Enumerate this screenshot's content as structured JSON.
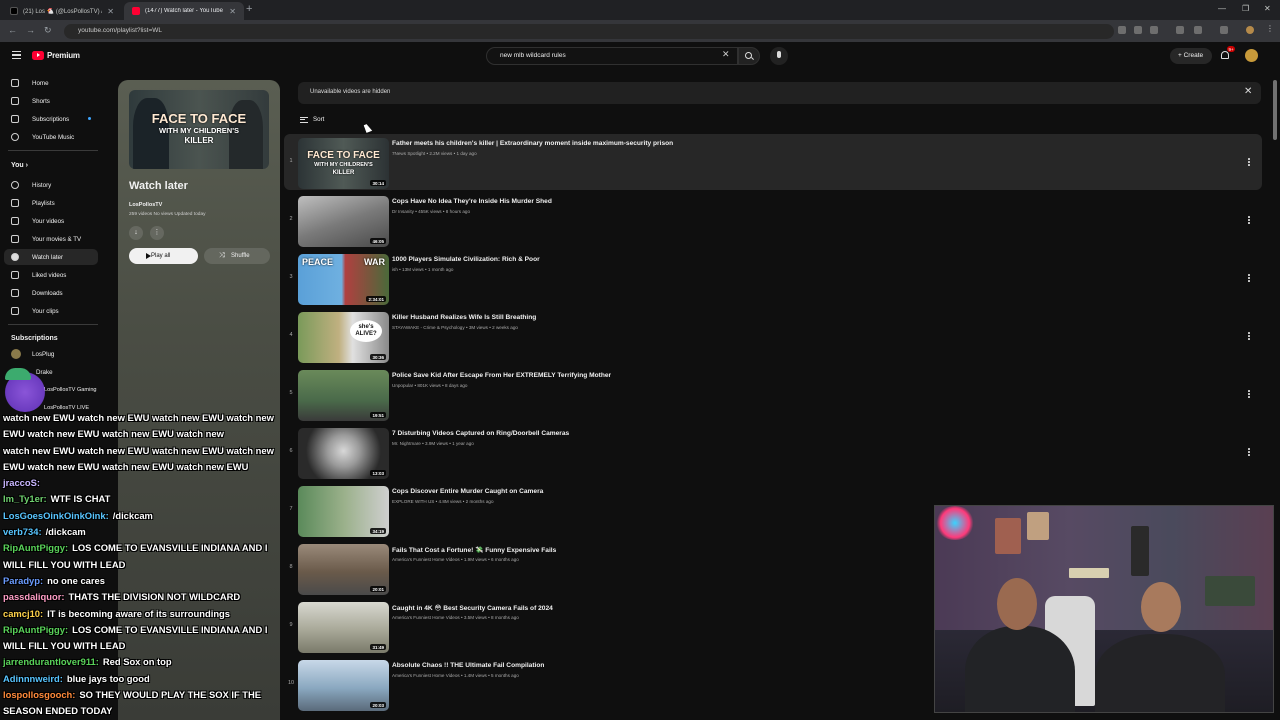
{
  "browser": {
    "tabs": [
      {
        "title": "(21) Los 🐔 (@LosPollosTV) / X",
        "active": false
      },
      {
        "title": "(1477) Watch later - YouTube",
        "active": true
      }
    ],
    "url": "youtube.com/playlist?list=WL"
  },
  "header": {
    "logo_text": "Premium",
    "search_value": "new mlb wildcard rules",
    "create_label": "Create",
    "notification_count": "9+"
  },
  "sidebar": {
    "main": [
      "Home",
      "Shorts",
      "Subscriptions",
      "YouTube Music"
    ],
    "you_label": "You",
    "you_items": [
      "History",
      "Playlists",
      "Your videos",
      "Your movies & TV",
      "Watch later",
      "Liked videos",
      "Downloads",
      "Your clips"
    ],
    "subs_label": "Subscriptions",
    "subs": [
      "LosPlug",
      "Drake",
      "LosPollosTV Gaming",
      "LosPollosTV LIVE"
    ]
  },
  "playlist": {
    "thumb_line1": "FACE TO FACE",
    "thumb_line2": "WITH MY CHILDREN'S",
    "thumb_line3": "KILLER",
    "title": "Watch later",
    "owner": "LosPollosTV",
    "meta": "259 videos  No views  Updated today",
    "play_all": "Play all",
    "shuffle": "Shuffle"
  },
  "list": {
    "notice": "Unavailable videos are hidden",
    "sort_label": "Sort",
    "videos": [
      {
        "n": "1",
        "title": "Father meets his children's killer | Extraordinary moment inside maximum-security prison",
        "meta": "7News Spotlight • 2.2M views • 1 day ago",
        "dur": "30:14"
      },
      {
        "n": "2",
        "title": "Cops Have No Idea They're Inside His Murder Shed",
        "meta": "Dr Insanity • 455K views • 8 hours ago",
        "dur": "46:05"
      },
      {
        "n": "3",
        "title": "1000 Players Simulate Civilization: Rich & Poor",
        "meta": "ish • 13M views • 1 month ago",
        "dur": "2:34:01"
      },
      {
        "n": "4",
        "title": "Killer Husband Realizes Wife Is Still Breathing",
        "meta": "STAYAWAKE - Crime & Psychology • 3M views • 2 weeks ago",
        "dur": "30:36"
      },
      {
        "n": "5",
        "title": "Police Save Kid After Escape From Her EXTREMELY Terrifying Mother",
        "meta": "Unpopular • 801K views • 8 days ago",
        "dur": "19:51"
      },
      {
        "n": "6",
        "title": "7 Disturbing Videos Captured on Ring/Doorbell Cameras",
        "meta": "Mr. Nightmare • 3.9M views • 1 year ago",
        "dur": "13:03"
      },
      {
        "n": "7",
        "title": "Cops Discover Entire Murder Caught on Camera",
        "meta": "EXPLORE WITH US • 4.8M views • 2 months ago",
        "dur": "34:19"
      },
      {
        "n": "8",
        "title": "Fails That Cost a Fortune! 💸 Funny Expensive Fails",
        "meta": "America's Funniest Home Videos • 1.9M views • 6 months ago",
        "dur": "20:01"
      },
      {
        "n": "9",
        "title": "Caught in 4K 😳 Best Security Camera Fails of 2024",
        "meta": "America's Funniest Home Videos • 3.5M views • 8 months ago",
        "dur": "31:49"
      },
      {
        "n": "10",
        "title": "Absolute Chaos !! THE Ultimate Fail Compilation",
        "meta": "America's Funniest Home Videos • 1.4M views • 5 months ago",
        "dur": "20:03"
      }
    ]
  },
  "chat": {
    "lines": [
      {
        "user": "",
        "msg": "watch new EWU watch new EWU watch new EWU watch new",
        "color": "#ffffff"
      },
      {
        "user": "",
        "msg": "EWU watch new EWU watch new EWU watch new",
        "color": "#ffffff"
      },
      {
        "user": "",
        "msg": "watch new EWU watch new EWU watch new EWU watch new",
        "color": "#ffffff"
      },
      {
        "user": "",
        "msg": "EWU watch new EWU watch new EWU watch new EWU",
        "color": "#ffffff"
      },
      {
        "user": "jraccoS:",
        "msg": "",
        "color": "#c9b6ff"
      },
      {
        "user": "Im_Ty1er:",
        "msg": "WTF IS CHAT",
        "color": "#6fd06f"
      },
      {
        "user": "LosGoesOinkOinkOink:",
        "msg": "/dickcam",
        "color": "#58c5ff"
      },
      {
        "user": "verb734:",
        "msg": "/dickcam",
        "color": "#58c5ff"
      },
      {
        "user": "RipAuntPiggy:",
        "msg": "LOS COME TO EVANSVILLE INDIANA AND I",
        "color": "#5ad35a"
      },
      {
        "user": "",
        "msg": "WILL FILL YOU WITH LEAD",
        "color": "#ffffff"
      },
      {
        "user": "Paradyp:",
        "msg": "no one cares",
        "color": "#6b9cff"
      },
      {
        "user": "passdaliquor:",
        "msg": "THATS THE DIVISION NOT WILDCARD",
        "color": "#ff9ec6"
      },
      {
        "user": "camcj10:",
        "msg": "IT is becoming aware of its surroundings",
        "color": "#ffd24a"
      },
      {
        "user": "RipAuntPiggy:",
        "msg": "LOS COME TO EVANSVILLE INDIANA AND I",
        "color": "#5ad35a"
      },
      {
        "user": "",
        "msg": "WILL FILL YOU WITH LEAD",
        "color": "#ffffff"
      },
      {
        "user": "jarrendurantlover911:",
        "msg": "Red Sox on top",
        "color": "#5ad35a"
      },
      {
        "user": "Adinnnweird:",
        "msg": "blue jays too good",
        "color": "#58c5ff"
      },
      {
        "user": "lospollosgooch:",
        "msg": "SO THEY WOULD PLAY THE SOX IF THE",
        "color": "#ff8a3a"
      },
      {
        "user": "",
        "msg": "SEASON ENDED TODAY",
        "color": "#ffffff"
      }
    ]
  },
  "colors": {
    "accent": "#ff0033",
    "bg": "#0f0f0f"
  }
}
